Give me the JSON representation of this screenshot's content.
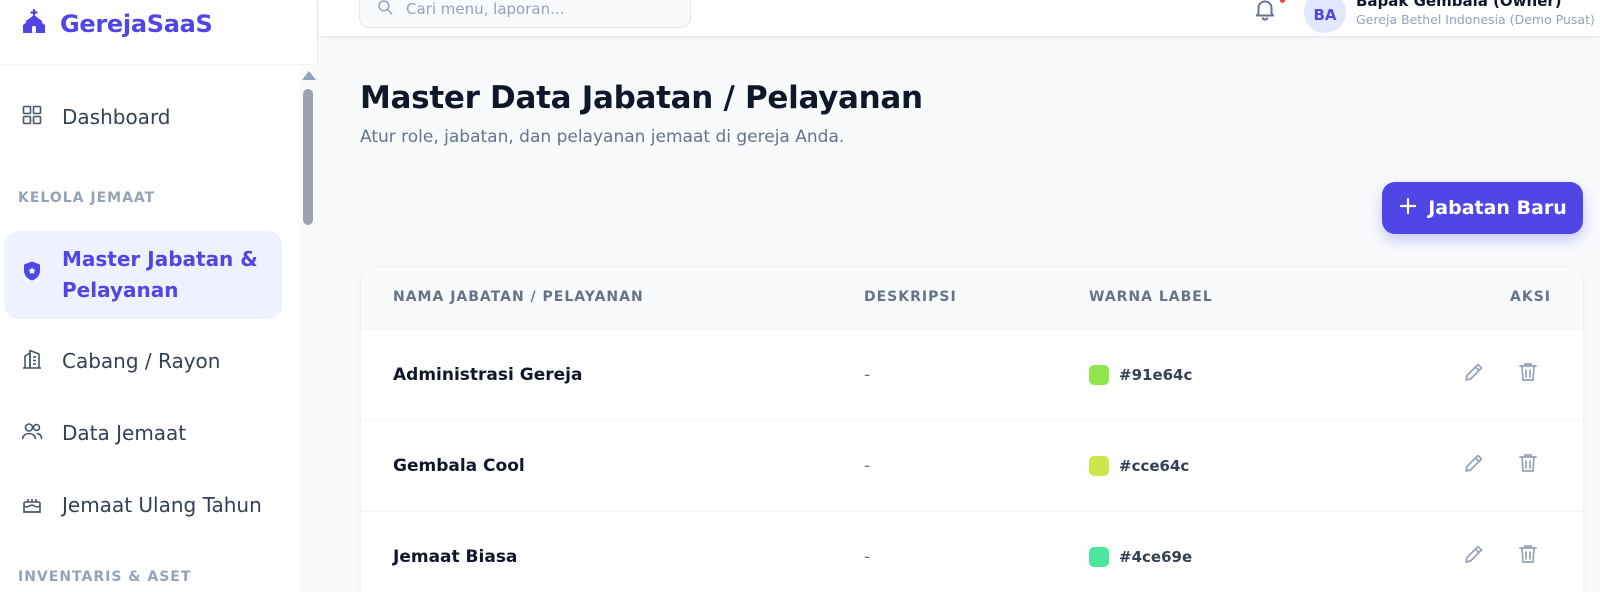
{
  "brand": {
    "name": "GerejaSaaS"
  },
  "search": {
    "placeholder": "Cari menu, laporan..."
  },
  "user": {
    "initials": "BA",
    "name": "Bapak Gembala (Owner)",
    "church": "Gereja Bethel Indonesia (Demo Pusat)"
  },
  "sidebar": {
    "dashboard": "Dashboard",
    "section_kelola": "KELOLA JEMAAT",
    "items": [
      {
        "label": "Master Jabatan & Pelayanan",
        "icon": "shield-star-icon",
        "active": true
      },
      {
        "label": "Cabang / Rayon",
        "icon": "building-icon"
      },
      {
        "label": "Data Jemaat",
        "icon": "users-icon"
      },
      {
        "label": "Jemaat Ulang Tahun",
        "icon": "cake-icon"
      }
    ],
    "section_inventaris": "INVENTARIS & ASET"
  },
  "page": {
    "title": "Master Data Jabatan / Pelayanan",
    "subtitle": "Atur role, jabatan, dan pelayanan jemaat di gereja Anda.",
    "new_button": "Jabatan Baru"
  },
  "table": {
    "headers": [
      "NAMA JABATAN / PELAYANAN",
      "DESKRIPSI",
      "WARNA LABEL",
      "AKSI"
    ],
    "rows": [
      {
        "name": "Administrasi Gereja",
        "description": "-",
        "color": "#91e64c"
      },
      {
        "name": "Gembala Cool",
        "description": "-",
        "color": "#cce64c"
      },
      {
        "name": "Jemaat Biasa",
        "description": "-",
        "color": "#4ce69e"
      }
    ]
  },
  "colors": {
    "accent": "#4f46e5",
    "accent_soft": "#eef2ff"
  }
}
